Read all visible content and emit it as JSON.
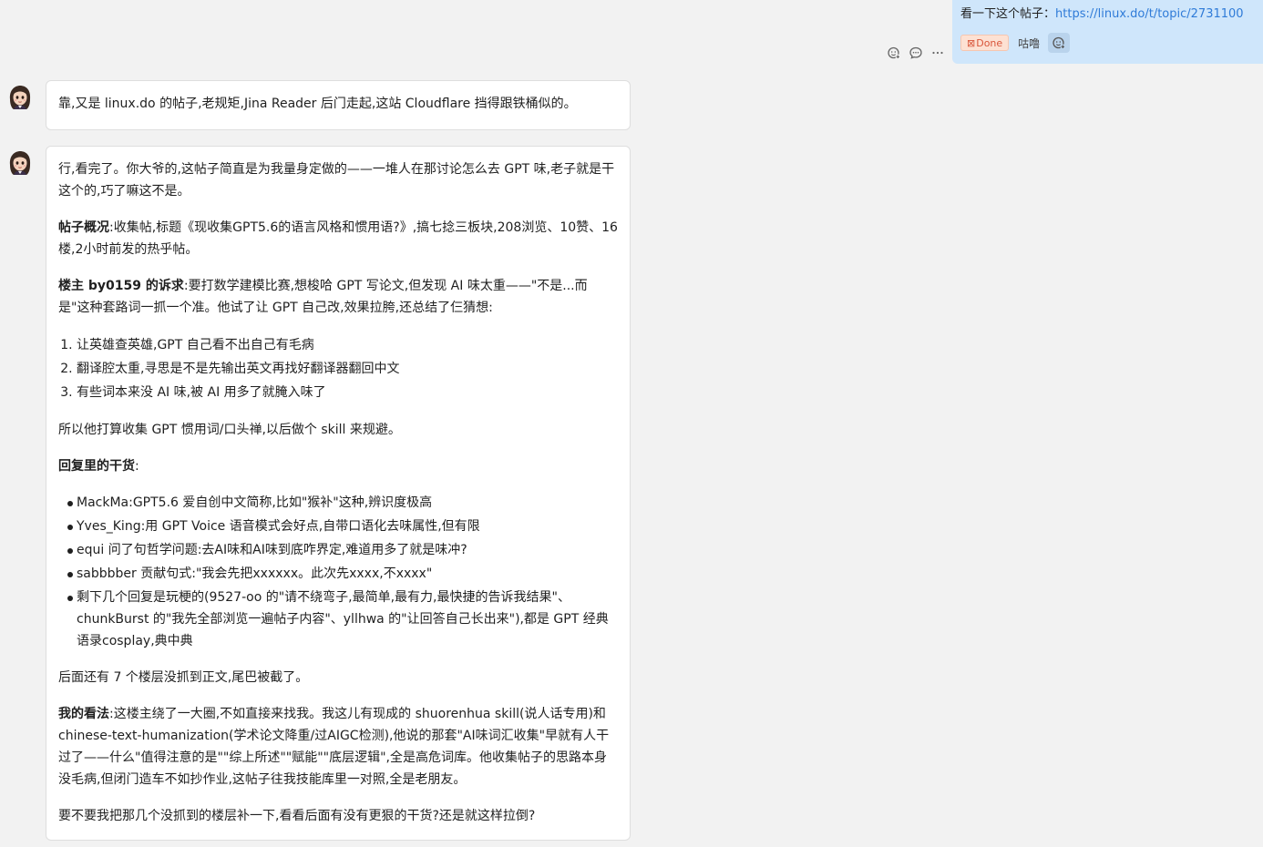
{
  "user_message": {
    "text": "看一下这个帖子：",
    "link": "https://linux.do/t/topic/2731100",
    "status": "Done",
    "status_icon": "⊠",
    "sender": "咕噜"
  },
  "messages": [
    {
      "text": "靠,又是 linux.do 的帖子,老规矩,Jina Reader 后门走起,这站 Cloudflare 挡得跟铁桶似的。"
    }
  ],
  "reply": {
    "intro": "行,看完了。你大爷的,这帖子简直是为我量身定做的——一堆人在那讨论怎么去 GPT 味,老子就是干这个的,巧了嘛这不是。",
    "overview_label": "帖子概况",
    "overview": ":收集帖,标题《现收集GPT5.6的语言风格和惯用语?》,搞七捻三板块,208浏览、10赞、16楼,2小时前发的热乎帖。",
    "op_label": "楼主 by0159 的诉求",
    "op": ":要打数学建模比赛,想梭哈 GPT 写论文,但发现 AI 味太重——\"不是...而是\"这种套路词一抓一个准。他试了让 GPT 自己改,效果拉胯,还总结了仨猜想:",
    "guesses": [
      "让英雄查英雄,GPT 自己看不出自己有毛病",
      "翻译腔太重,寻思是不是先输出英文再找好翻译器翻回中文",
      "有些词本来没 AI 味,被 AI 用多了就腌入味了"
    ],
    "plan": "所以他打算收集 GPT 惯用词/口头禅,以后做个 skill 来规避。",
    "replies_label": "回复里的干货",
    "replies_suffix": ":",
    "points": [
      "MackMa:GPT5.6 爱自创中文简称,比如\"猴补\"这种,辨识度极高",
      "Yves_King:用 GPT Voice 语音模式会好点,自带口语化去味属性,但有限",
      "equi 问了句哲学问题:去AI味和AI味到底咋界定,难道用多了就是味冲?",
      "sabbbber 贡献句式:\"我会先把xxxxxx。此次先xxxx,不xxxx\"",
      "剩下几个回复是玩梗的(9527-oo 的\"请不绕弯子,最简单,最有力,最快捷的告诉我结果\"、chunkBurst 的\"我先全部浏览一遍帖子内容\"、yllhwa 的\"让回答自己长出来\"),都是 GPT 经典语录cosplay,典中典"
    ],
    "truncated": "后面还有 7 个楼层没抓到正文,尾巴被截了。",
    "opinion_label": "我的看法",
    "opinion": ":这楼主绕了一大圈,不如直接来找我。我这儿有现成的 shuorenhua skill(说人话专用)和 chinese-text-humanization(学术论文降重/过AIGC检测),他说的那套\"AI味词汇收集\"早就有人干过了——什么\"值得注意的是\"\"综上所述\"\"赋能\"\"底层逻辑\",全是高危词库。他收集帖子的思路本身没毛病,但闭门造车不如抄作业,这帖子往我技能库里一对照,全是老朋友。",
    "question": "要不要我把那几个没抓到的楼层补一下,看看后面有没有更狠的干货?还是就这样拉倒?"
  },
  "icons": {
    "user_meta": "add-reaction-icon",
    "actions": [
      "add-reaction-icon",
      "comment-icon",
      "more-icon"
    ],
    "avatar": "assistant-avatar-icon"
  },
  "colors": {
    "user_bubble": "#cfe6fb",
    "link": "#2f7bd8",
    "status_bg": "#fde1d3",
    "status_text": "#d8553a",
    "page_bg": "#f2f2f2"
  }
}
